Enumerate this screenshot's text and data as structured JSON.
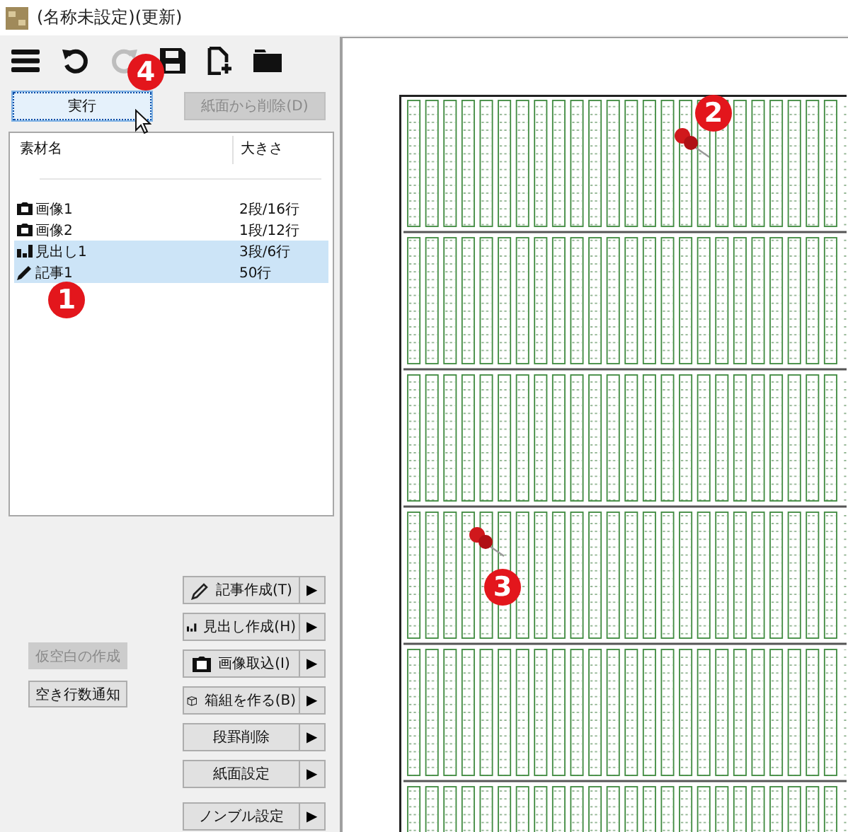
{
  "window": {
    "title": "(名称未設定)(更新)"
  },
  "toolbar": [
    {
      "kind": "menu",
      "disabled": false
    },
    {
      "kind": "undo",
      "disabled": false
    },
    {
      "kind": "redo",
      "disabled": true
    },
    {
      "kind": "save",
      "disabled": false
    },
    {
      "kind": "new",
      "disabled": false
    },
    {
      "kind": "open",
      "disabled": false
    }
  ],
  "actions": [
    {
      "label": "実行",
      "focused": true,
      "disabled": false
    },
    {
      "label": "紙面から削除(D)",
      "focused": false,
      "disabled": true
    }
  ],
  "materials": {
    "columns": [
      "素材名",
      "大きさ"
    ],
    "rows": [
      {
        "kind": "image",
        "name": "画像1",
        "size": "2段/16行",
        "selected": false
      },
      {
        "kind": "image",
        "name": "画像2",
        "size": "1段/12行",
        "selected": false
      },
      {
        "kind": "heading",
        "name": "見出し1",
        "size": "3段/6行",
        "selected": true
      },
      {
        "kind": "article",
        "name": "記事1",
        "size": "50行",
        "selected": true
      }
    ]
  },
  "side_buttons": [
    {
      "label": "仮空白の作成",
      "disabled": true
    },
    {
      "label": "空き行数通知",
      "disabled": false
    }
  ],
  "create_buttons": [
    {
      "kind": "article",
      "label": "記事作成(T)",
      "arrow": "▶"
    },
    {
      "kind": "heading",
      "label": "見出し作成(H)",
      "arrow": "▶"
    },
    {
      "kind": "image",
      "label": "画像取込(I)",
      "arrow": "▶"
    },
    {
      "kind": "box",
      "label": "箱組を作る(B)",
      "arrow": "▶"
    },
    {
      "kind": "none",
      "label": "段罫削除",
      "arrow": "▶"
    },
    {
      "kind": "none",
      "label": "紙面設定",
      "arrow": "▶"
    },
    {
      "kind": "none",
      "label": "ノンブル設定",
      "arrow": "▶"
    }
  ],
  "markers": [
    {
      "label": "1"
    },
    {
      "label": "2"
    },
    {
      "label": "3"
    },
    {
      "label": "4"
    }
  ]
}
